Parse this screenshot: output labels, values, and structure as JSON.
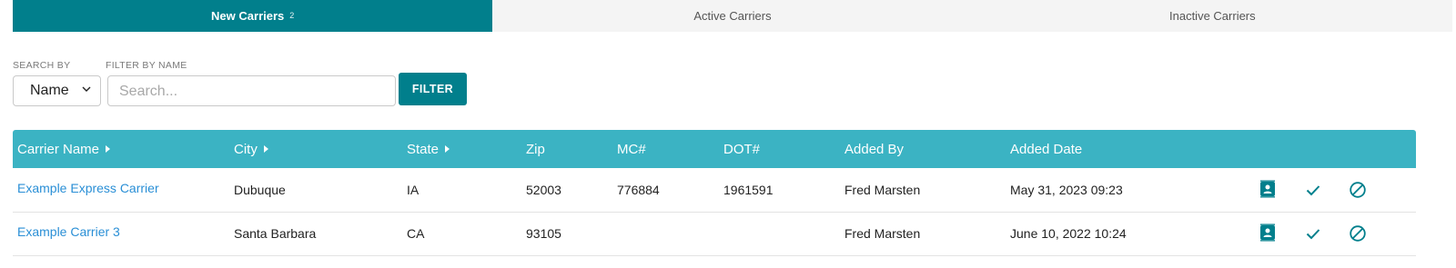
{
  "colors": {
    "primary": "#017f8c",
    "header": "#3bb3c3",
    "link": "#2a8fd6"
  },
  "tabs": [
    {
      "label": "New Carriers",
      "count": "2",
      "active": true
    },
    {
      "label": "Active Carriers",
      "active": false
    },
    {
      "label": "Inactive Carriers",
      "active": false
    }
  ],
  "filters": {
    "search_by_label": "SEARCH BY",
    "search_by_value": "Name",
    "filter_by_name_label": "FILTER BY NAME",
    "search_placeholder": "Search...",
    "filter_button": "FILTER"
  },
  "table": {
    "columns": [
      "Carrier Name",
      "City",
      "State",
      "Zip",
      "MC#",
      "DOT#",
      "Added By",
      "Added Date"
    ],
    "rows": [
      {
        "carrier_name": "Example Express Carrier",
        "city": "Dubuque",
        "state": "IA",
        "zip": "52003",
        "mc": "776884",
        "dot": "1961591",
        "added_by": "Fred Marsten",
        "added_date": "May 31, 2023 09:23"
      },
      {
        "carrier_name": "Example Carrier 3",
        "city": "Santa Barbara",
        "state": "CA",
        "zip": "93105",
        "mc": "",
        "dot": "",
        "added_by": "Fred Marsten",
        "added_date": "June 10, 2022 10:24"
      }
    ],
    "row_actions": [
      "contact-card-icon",
      "checkmark-icon",
      "block-icon"
    ]
  }
}
